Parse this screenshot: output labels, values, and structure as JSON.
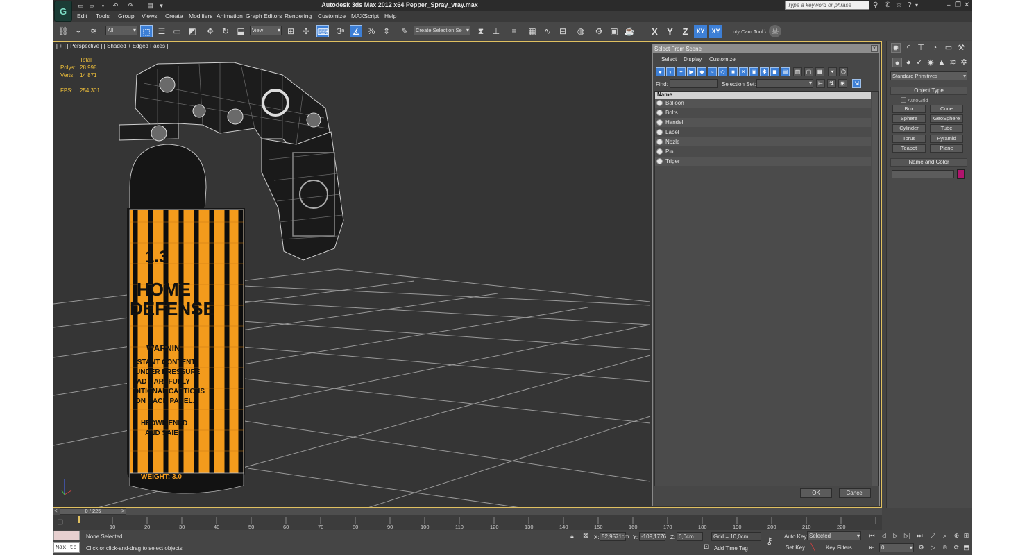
{
  "app": {
    "title": "Autodesk 3ds Max  2012 x64     Pepper_Spray_vray.max",
    "search_placeholder": "Type a keyword or phrase",
    "accent_color": "#3d7fd6"
  },
  "menu": [
    "Edit",
    "Tools",
    "Group",
    "Views",
    "Create",
    "Modifiers",
    "Animation",
    "Graph Editors",
    "Rendering",
    "Customize",
    "MAXScript",
    "Help"
  ],
  "toolbar": {
    "filter_value": "All",
    "ref_coord_value": "View",
    "selection_set_placeholder": "Create Selection Se",
    "snap_number": "3",
    "axis_x": "X",
    "axis_y": "Y",
    "axis_z": "Z",
    "axis_xy": "XY",
    "axis_xy2": "XY",
    "cam_tool_label": "uty Cam Tool \\"
  },
  "viewport": {
    "label": "[ + ] [ Perspective ] [ Shaded + Edged Faces ]",
    "stats_header": "Total",
    "polys_label": "Polys:",
    "polys_value": "28 998",
    "verts_label": "Verts:",
    "verts_value": "14 871",
    "fps_label": "FPS:",
    "fps_value": "254,301",
    "can_text_1": "1.3",
    "can_text_2": "HOME",
    "can_text_3": "DEFENSE",
    "can_text_4": "WARNIN",
    "can_warn_lines": [
      "ISTANT CONTENT",
      "UNDER PRESSURE",
      "AD CAREFULLY",
      "DITIONAL CAUTIONS",
      "ON BACK PANEL.",
      "",
      "HEDWITENED",
      "AND SAIE"
    ],
    "can_bottom": "WEIGHT: 3.0"
  },
  "dialog": {
    "title": "Select From Scene",
    "menu": [
      "Select",
      "Display",
      "Customize"
    ],
    "find_label": "Find:",
    "selection_set_label": "Selection Set:",
    "column_name": "Name",
    "items": [
      "Balloon",
      "Bolts",
      "Handel",
      "Label",
      "Nozle",
      "Pin",
      "Triger"
    ],
    "ok_label": "OK",
    "cancel_label": "Cancel"
  },
  "command_panel": {
    "category": "Standard Primitives",
    "object_type_title": "Object Type",
    "autogrid_label": "AutoGrid",
    "primitives": [
      "Box",
      "Cone",
      "Sphere",
      "GeoSphere",
      "Cylinder",
      "Tube",
      "Torus",
      "Pyramid",
      "Teapot",
      "Plane"
    ],
    "name_color_title": "Name and Color",
    "object_color": "#b1146d"
  },
  "timeline": {
    "slider_label": "0 / 225",
    "ticks": [
      "10",
      "20",
      "30",
      "40",
      "50",
      "60",
      "70",
      "80",
      "90",
      "100",
      "110",
      "120",
      "130",
      "140",
      "150",
      "160",
      "170",
      "180",
      "190",
      "200",
      "210",
      "220"
    ]
  },
  "status": {
    "maxscript_text": "Max to",
    "selection_text": "None Selected",
    "prompt_text": "Click or click-and-drag to select objects",
    "x_label": "X:",
    "x_value": "52,9571cm",
    "y_label": "Y:",
    "y_value": "-109,1776",
    "z_label": "Z:",
    "z_value": "0,0cm",
    "grid_text": "Grid = 10,0cm",
    "add_time_tag": "Add Time Tag",
    "auto_key": "Auto Key",
    "set_key": "Set Key",
    "key_mode_value": "Selected",
    "key_filters": "Key Filters...",
    "frame_value": "0"
  }
}
